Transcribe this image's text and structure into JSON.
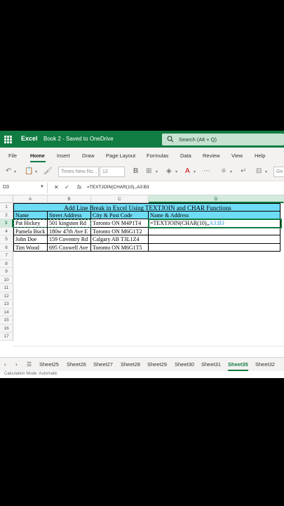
{
  "titlebar": {
    "app_name": "Excel",
    "doc_title": "Book 2 - Saved to OneDrive",
    "search_placeholder": "Search (Alt + Q)"
  },
  "menu_tabs": [
    "File",
    "Home",
    "Insert",
    "Draw",
    "Page Layout",
    "Formulas",
    "Data",
    "Review",
    "View",
    "Help"
  ],
  "active_tab": "Home",
  "ribbon": {
    "font_name": "Times New Ro...",
    "font_size": "12",
    "more": "Ge"
  },
  "formula_bar": {
    "name_box": "D3",
    "formula_prefix": "=TEXTJOIN(CHAR(10),,",
    "formula_ref": "A3:B3"
  },
  "columns": [
    "A",
    "B",
    "C",
    "D"
  ],
  "rows": [
    "1",
    "2",
    "3",
    "4",
    "5",
    "6",
    "7",
    "8",
    "9",
    "10",
    "11",
    "12",
    "13",
    "14",
    "15",
    "16",
    "17"
  ],
  "sheet": {
    "title": "Add Line Break in Excel Using TEXTJOIN and CHAR Functions",
    "headers": [
      "Name",
      "Street Address",
      "City & Post Code",
      "Name & Address"
    ],
    "data": [
      [
        "Pat Hickey",
        "501 kingston Rd",
        "Toronto ON  M4P1T4"
      ],
      [
        "Pamela Buck",
        "180w 47th Ave E",
        "Toronto ON M6G1T2"
      ],
      [
        "John Doe",
        "159 Coventry Rd",
        "Calgary AB T3L1Z4"
      ],
      [
        "Tim Wood",
        "695 Coxwell Ave",
        "Toronto ON M6G1T5"
      ]
    ],
    "edit_prefix": "=TEXTJOIN(CHAR(10),,",
    "edit_ref": "A3:B3"
  },
  "sheet_tabs": [
    "Sheet25",
    "Sheet26",
    "Sheet27",
    "Sheet28",
    "Sheet29",
    "Sheet30",
    "Sheet31",
    "Sheet35",
    "Sheet32"
  ],
  "active_sheet": "Sheet35",
  "status": "Calculation Mode: Automatic"
}
